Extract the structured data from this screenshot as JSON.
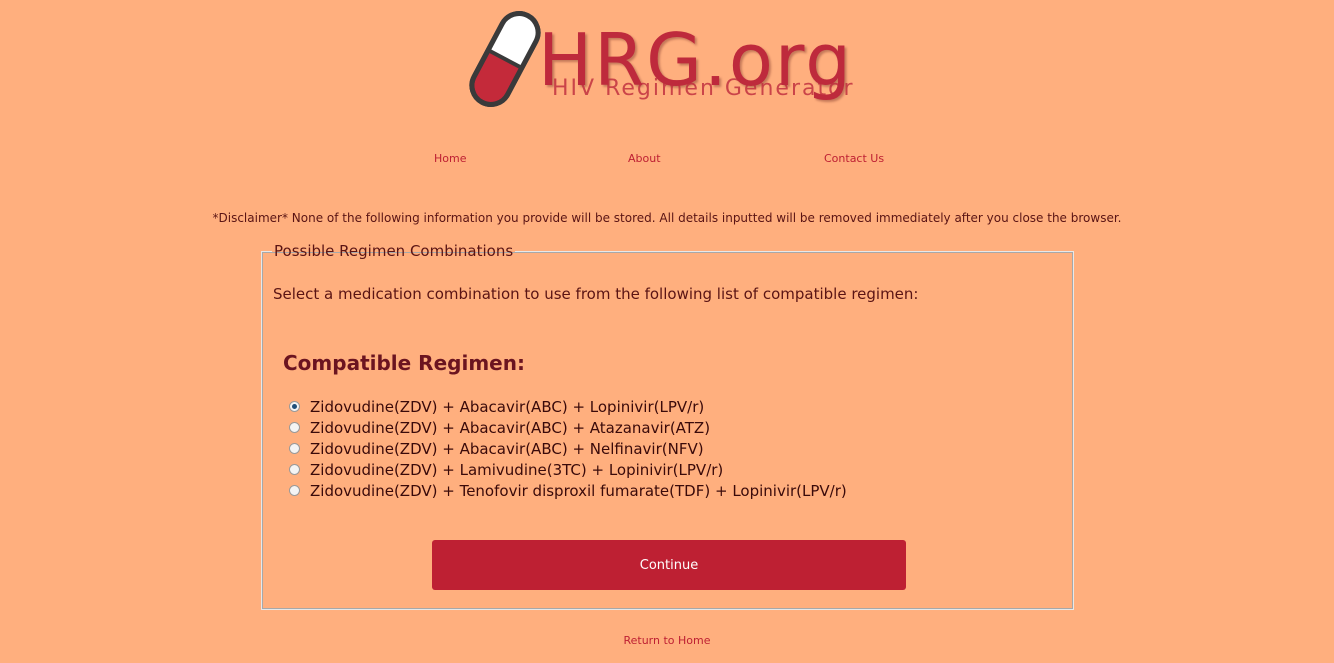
{
  "logo": {
    "text": "HRG.org",
    "subtitle": "HIV Regimen Generator",
    "icon": "pill-capsule-icon"
  },
  "nav": {
    "items": [
      {
        "label": "Home"
      },
      {
        "label": "About"
      },
      {
        "label": "Contact Us"
      }
    ]
  },
  "disclaimer": "*Disclaimer* None of the following information you provide will be stored. All details inputted will be removed immediately after you close the browser.",
  "panel": {
    "legend": "Possible Regimen Combinations",
    "instruction": "Select a medication combination to use from the following list of compatible regimen:",
    "heading": "Compatible Regimen:",
    "options": [
      {
        "label": "Zidovudine(ZDV) + Abacavir(ABC) + Lopinivir(LPV/r)",
        "checked": true
      },
      {
        "label": "Zidovudine(ZDV) + Abacavir(ABC) + Atazanavir(ATZ)",
        "checked": false
      },
      {
        "label": "Zidovudine(ZDV) + Abacavir(ABC) + Nelfinavir(NFV)",
        "checked": false
      },
      {
        "label": "Zidovudine(ZDV) + Lamivudine(3TC) + Lopinivir(LPV/r)",
        "checked": false
      },
      {
        "label": "Zidovudine(ZDV) + Tenofovir disproxil fumarate(TDF) + Lopinivir(LPV/r)",
        "checked": false
      }
    ],
    "continue_label": "Continue"
  },
  "footer": {
    "return_label": "Return to Home"
  },
  "colors": {
    "background": "#ffaf7e",
    "accent": "#be2033",
    "text": "#5a1414"
  }
}
